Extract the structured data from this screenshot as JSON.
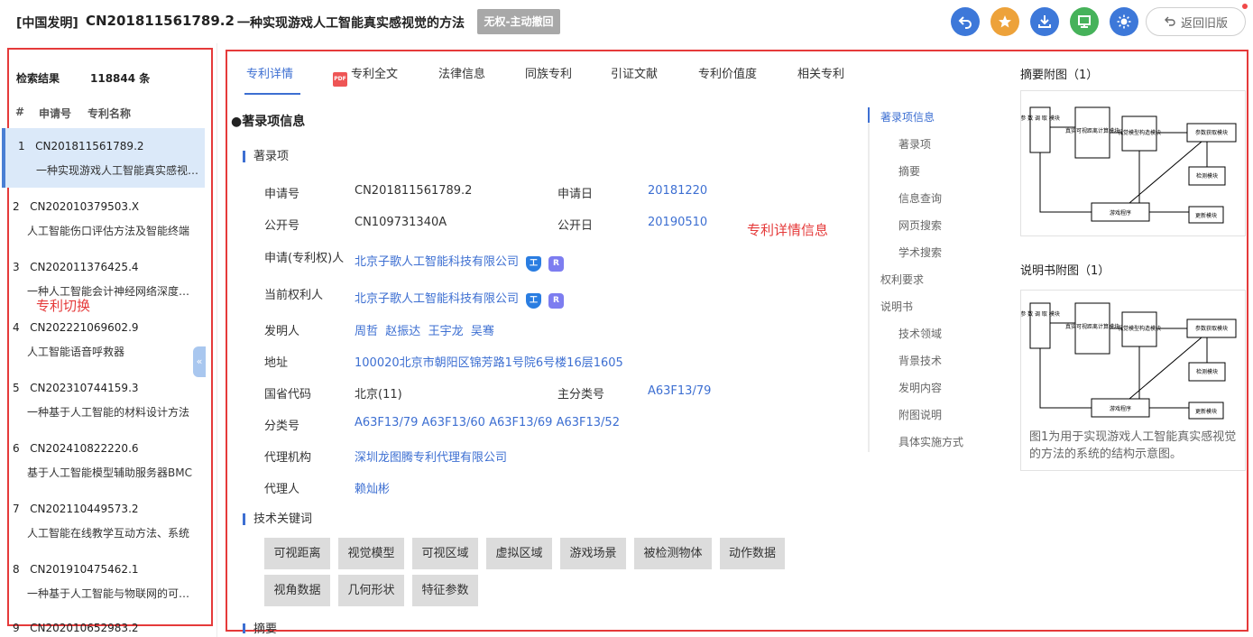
{
  "header": {
    "type": "[中国发明]",
    "number": "CN201811561789.2",
    "title": "一种实现游戏人工智能真实感视觉的方法",
    "badge": "无权-主动撤回",
    "old_version": "返回旧版",
    "colors": {
      "undo": "#3d78d9",
      "star": "#eda23a",
      "download": "#3d78d9",
      "monitor": "#46b25a",
      "theme": "#3d78d9"
    }
  },
  "sidebar": {
    "results_label": "检索结果",
    "results_count": "118844 条",
    "col_index": "#",
    "col_appno": "申请号",
    "col_name": "专利名称",
    "annotation": "专利切换",
    "items": [
      {
        "num": "1",
        "appno": "CN201811561789.2",
        "name": "一种实现游戏人工智能真实感视觉的方法"
      },
      {
        "num": "2",
        "appno": "CN202010379503.X",
        "name": "人工智能伤口评估方法及智能终端"
      },
      {
        "num": "3",
        "appno": "CN202011376425.4",
        "name": "一种人工智能会计神经网络深度学习方法"
      },
      {
        "num": "4",
        "appno": "CN202221069602.9",
        "name": "人工智能语音呼救器"
      },
      {
        "num": "5",
        "appno": "CN202310744159.3",
        "name": "一种基于人工智能的材料设计方法"
      },
      {
        "num": "6",
        "appno": "CN202410822220.6",
        "name": "基于人工智能模型辅助服务器BMC"
      },
      {
        "num": "7",
        "appno": "CN202110449573.2",
        "name": "人工智能在线教学互动方法、系统"
      },
      {
        "num": "8",
        "appno": "CN201910475462.1",
        "name": "一种基于人工智能与物联网的可视化"
      },
      {
        "num": "9",
        "appno": "CN202010652983.2",
        "name": ""
      }
    ]
  },
  "tabs": [
    {
      "label": "专利详情"
    },
    {
      "label": "专利全文"
    },
    {
      "label": "法律信息"
    },
    {
      "label": "同族专利"
    },
    {
      "label": "引证文献"
    },
    {
      "label": "专利价值度"
    },
    {
      "label": "相关专利"
    }
  ],
  "pdf_icon_text": "PDF",
  "detail": {
    "section_title": "●著录项信息",
    "sub_biblio": "著录项",
    "annotation": "专利详情信息",
    "app_no_label": "申请号",
    "app_no": "CN201811561789.2",
    "app_date_label": "申请日",
    "app_date": "20181220",
    "pub_no_label": "公开号",
    "pub_no": "CN109731340A",
    "pub_date_label": "公开日",
    "pub_date": "20190510",
    "applicant_label": "申请(专利权)人",
    "applicant": "北京子歌人工智能科技有限公司",
    "owner_label": "当前权利人",
    "owner": "北京子歌人工智能科技有限公司",
    "badge_i": "工",
    "badge_r": "R",
    "inventor_label": "发明人",
    "inventors": [
      "周哲",
      "赵振达",
      "王宇龙",
      "吴骞"
    ],
    "address_label": "地址",
    "address": "100020北京市朝阳区锦芳路1号院6号楼16层1605",
    "province_label": "国省代码",
    "province": "北京(11)",
    "main_class_label": "主分类号",
    "main_class": "A63F13/79",
    "class_label": "分类号",
    "classes": [
      "A63F13/79",
      "A63F13/60",
      "A63F13/69",
      "A63F13/52"
    ],
    "agency_label": "代理机构",
    "agency": "深圳龙图腾专利代理有限公司",
    "agent_label": "代理人",
    "agent": "赖灿彬",
    "sub_keywords": "技术关键词",
    "keywords": [
      "可视距离",
      "视觉模型",
      "可视区域",
      "虚拟区域",
      "游戏场景",
      "被检测物体",
      "动作数据",
      "视角数据",
      "几何形状",
      "特征参数"
    ],
    "sub_abstract": "摘要"
  },
  "toc": [
    {
      "label": "著录项信息"
    },
    {
      "label": "著录项"
    },
    {
      "label": "摘要"
    },
    {
      "label": "信息查询"
    },
    {
      "label": "网页搜索"
    },
    {
      "label": "学术搜索"
    },
    {
      "label": "权利要求"
    },
    {
      "label": "说明书"
    },
    {
      "label": "技术领域"
    },
    {
      "label": "背景技术"
    },
    {
      "label": "发明内容"
    },
    {
      "label": "附图说明"
    },
    {
      "label": "具体实施方式"
    }
  ],
  "figures": {
    "abstract_title": "摘要附图（1）",
    "desc_title": "说明书附图（1）",
    "caption": "图1为用于实现游戏人工智能真实感视觉的方法的系统的结构示意图。",
    "diagram_labels": {
      "param": "参 数 调 取 模块",
      "dist": "真实可视距离计算模块",
      "vision": "视觉模型构造模块",
      "acquire": "参数获取模块",
      "detect": "检测模块",
      "game": "游戏程序",
      "update": "更新模块"
    }
  }
}
